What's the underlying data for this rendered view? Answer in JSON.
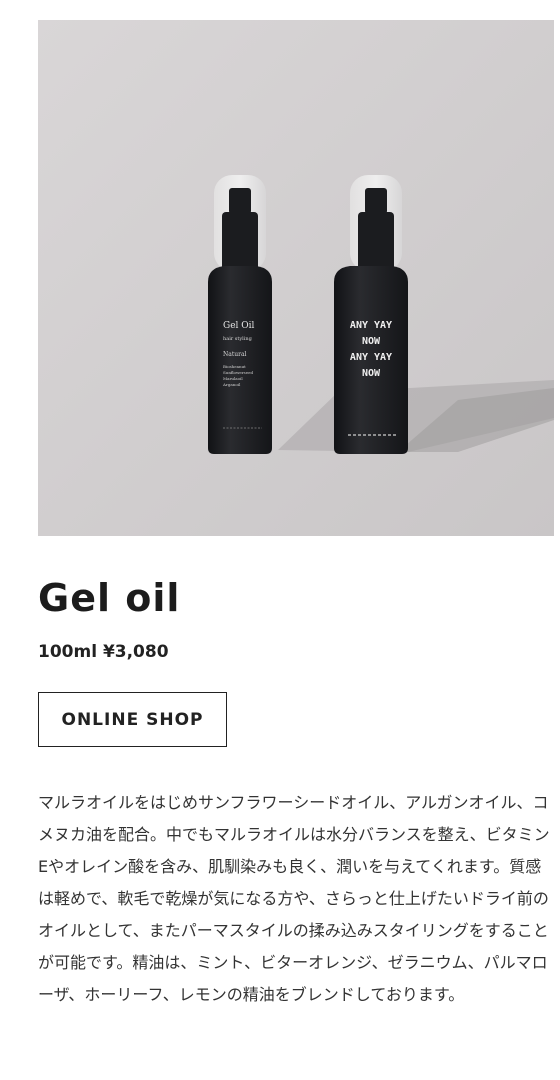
{
  "product": {
    "title": "Gel oil",
    "price": "100ml ¥3,080",
    "shop_button": "ONLINE SHOP",
    "description": "マルラオイルをはじめサンフラワーシードオイル、アルガンオイル、コメヌカ油を配合。中でもマルラオイルは水分バランスを整え、ビタミンEやオレイン酸を含み、肌馴染みも良く、潤いを与えてくれます。質感は軽めで、軟毛で乾燥が気になる方や、さらっと仕上げたいドライ前のオイルとして、またパーマスタイルの揉み込みスタイリングをすることが可能です。精油は、ミント、ビターオレンジ、ゼラニウム、パルマローザ、ホーリーフ、レモンの精油をブレンドしております。"
  },
  "bottle_left": {
    "name": "Gel Oil",
    "subtitle": "hair styling",
    "variant": "Natural",
    "ingredients": [
      "Biosheanut",
      "Sunflowerseed",
      "Marulaoil",
      "Arganoil"
    ]
  },
  "bottle_right": {
    "lines": [
      "ANY YAY",
      "NOW",
      "ANY YAY",
      "NOW"
    ]
  },
  "colors": {
    "background_wall": "#d3d0d0",
    "bottle": "#1e1f22",
    "text": "#222222"
  }
}
